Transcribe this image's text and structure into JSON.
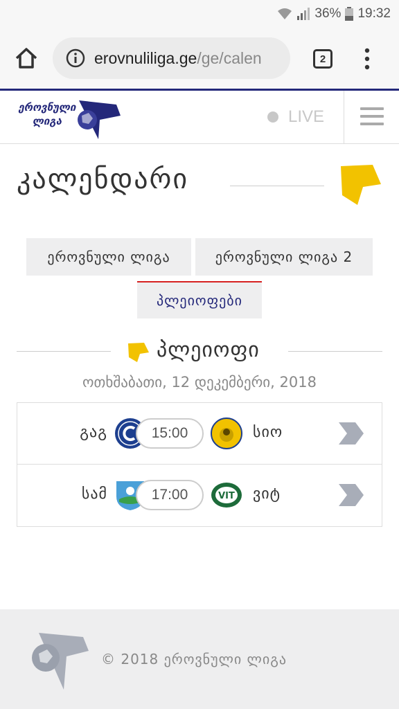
{
  "status_bar": {
    "battery": "36%",
    "time": "19:32"
  },
  "browser": {
    "url_host": "erovnuliliga.ge",
    "url_path": "/ge/calen",
    "tab_count": "2"
  },
  "header": {
    "logo_text": "ეროვნული ლიგა",
    "live_label": "LIVE"
  },
  "page": {
    "title": "კალენდარი"
  },
  "tabs": [
    {
      "label": "ეროვნული ლიგა"
    },
    {
      "label": "ეროვნული ლიგა 2"
    },
    {
      "label": "პლეიოფები",
      "active": true
    }
  ],
  "section": {
    "title": "პლეიოფი",
    "date": "ოთხშაბათი, 12 დეკემბერი, 2018"
  },
  "matches": [
    {
      "home": "გაგ",
      "time": "15:00",
      "away": "სიო"
    },
    {
      "home": "სამ",
      "time": "17:00",
      "away": "ვიტ"
    }
  ],
  "footer": {
    "copyright": "© 2018 ეროვნული ლიგა"
  },
  "colors": {
    "brand_navy": "#24287a",
    "accent_yellow": "#f2c200",
    "active_tab_border": "#d62020"
  }
}
